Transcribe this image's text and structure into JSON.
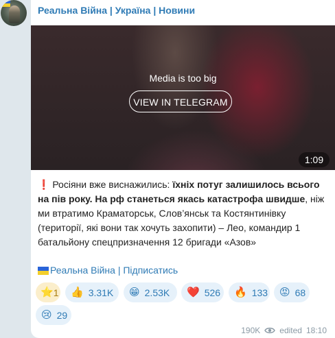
{
  "channel": {
    "name": "Реальна Війна | Україна | Новини"
  },
  "media": {
    "message": "Media is too big",
    "button_label": "VIEW IN TELEGRAM",
    "duration": "1:09"
  },
  "post": {
    "exclamation": "❗",
    "seg1": "Росіяни вже виснажились: ",
    "seg2_bold": "їхніх потуг залишилось всього на пів року. На рф станеться якась катастрофа швидше",
    "seg3": ", ніж ми втратимо Краматорськ, Слов’янськ та Костянтинівку (території, які вони так хочуть захопити) – Лео, командир 1 батальйону спецпризначення 12 бригади «Азов»"
  },
  "footer_link": {
    "label": "Реальна Війна | Підписатись"
  },
  "reactions": [
    {
      "icon": "star-icon",
      "emoji": "⭐",
      "count": "1"
    },
    {
      "icon": "thumbs-up-icon",
      "emoji": "👍",
      "count": "3.31K"
    },
    {
      "icon": "grin-icon",
      "emoji": "😁",
      "count": "2.53K"
    },
    {
      "icon": "heart-icon",
      "emoji": "❤️",
      "count": "526"
    },
    {
      "icon": "fire-icon",
      "emoji": "🔥",
      "count": "133"
    },
    {
      "icon": "angry-icon",
      "emoji": "😡",
      "count": "68"
    },
    {
      "icon": "crying-icon",
      "emoji": "😢",
      "count": "29"
    }
  ],
  "meta": {
    "views": "190K",
    "edited": "edited",
    "time": "18:10"
  },
  "colors": {
    "accent": "#2f7bb5",
    "background": "#dfe7ec",
    "reaction_bg": "#e6f1fa"
  }
}
